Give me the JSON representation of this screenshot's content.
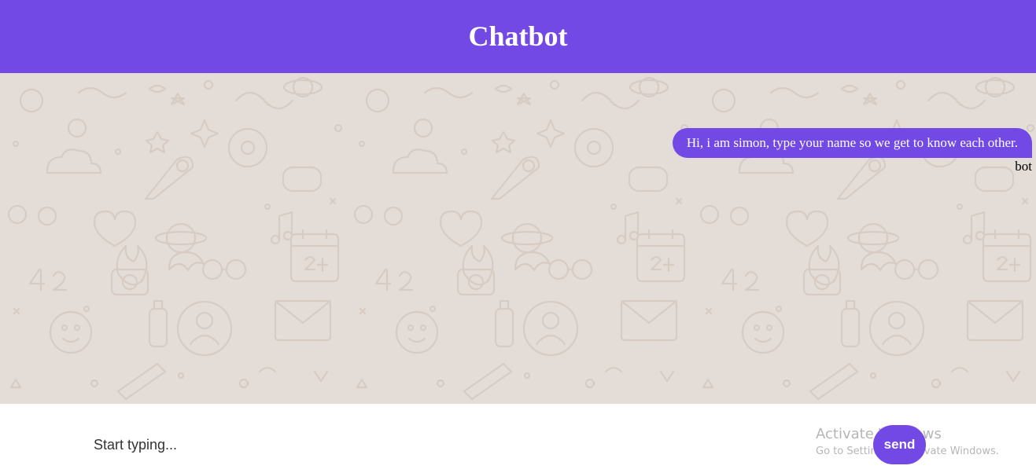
{
  "header": {
    "title": "Chatbot"
  },
  "chat": {
    "messages": [
      {
        "text": "Hi, i am simon, type your name so we get to know each other.",
        "sender": "bot"
      }
    ]
  },
  "composer": {
    "placeholder": "Start typing...",
    "value": "",
    "send_label": "send"
  },
  "watermark": {
    "title": "Activate Windows",
    "subtitle": "Go to Settings to activate Windows."
  },
  "colors": {
    "accent": "#7349e6",
    "chat_background": "#e4dcd6",
    "pattern": "#d6ccc4"
  },
  "icons": {
    "background": "doodle-pattern"
  }
}
